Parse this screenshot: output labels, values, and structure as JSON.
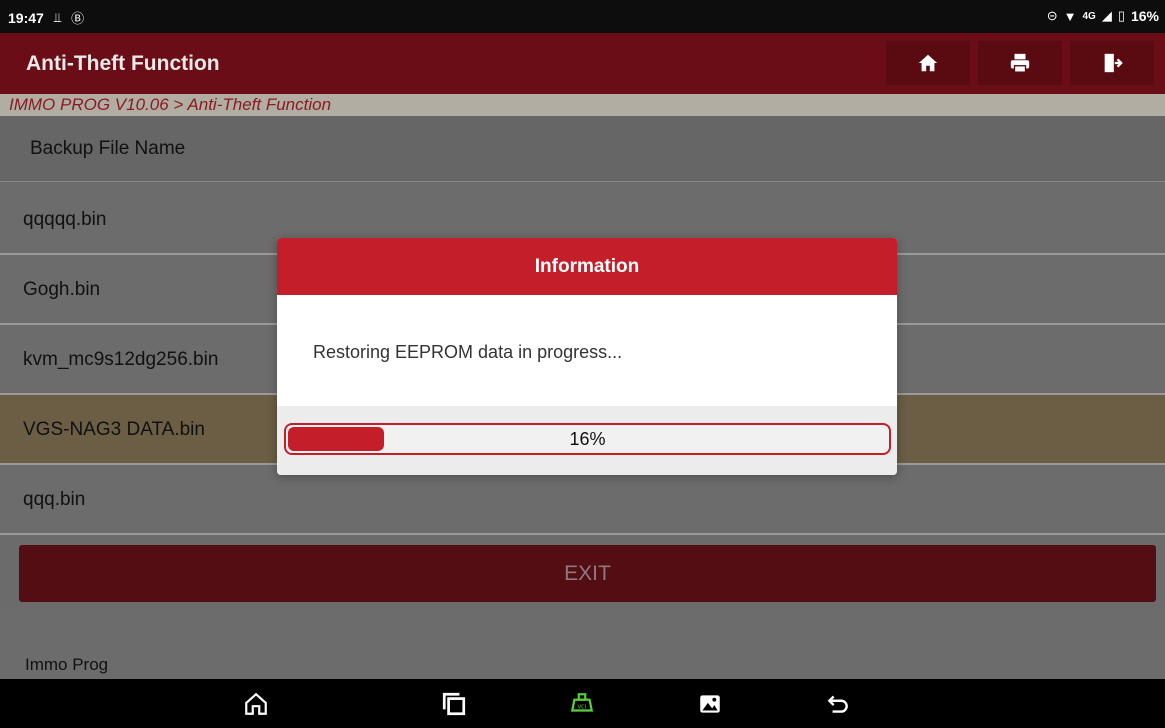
{
  "status_bar": {
    "time": "19:47",
    "battery": "16%",
    "network": "4G"
  },
  "header": {
    "title": "Anti-Theft Function",
    "home_icon": "home-icon",
    "print_icon": "print-icon",
    "exit_icon": "exit-door-icon"
  },
  "breadcrumb": "IMMO PROG V10.06 > Anti-Theft Function",
  "table": {
    "column_header": "Backup File Name",
    "rows": [
      "qqqqq.bin",
      "Gogh.bin",
      "kvm_mc9s12dg256.bin",
      "VGS-NAG3 DATA.bin",
      "qqq.bin"
    ],
    "selected_index": 3
  },
  "exit_button": "EXIT",
  "footer_label": "Immo Prog",
  "dialog": {
    "title": "Information",
    "message": "Restoring EEPROM data in progress...",
    "progress_percent": 16,
    "progress_label": "16%"
  },
  "colors": {
    "accent": "#c41e2b",
    "titlebar": "#6b0d16",
    "selected_row": "#6b5e44"
  },
  "nav_icons": [
    "home-outline-icon",
    "recent-apps-icon",
    "vci-icon",
    "gallery-icon",
    "back-icon"
  ]
}
